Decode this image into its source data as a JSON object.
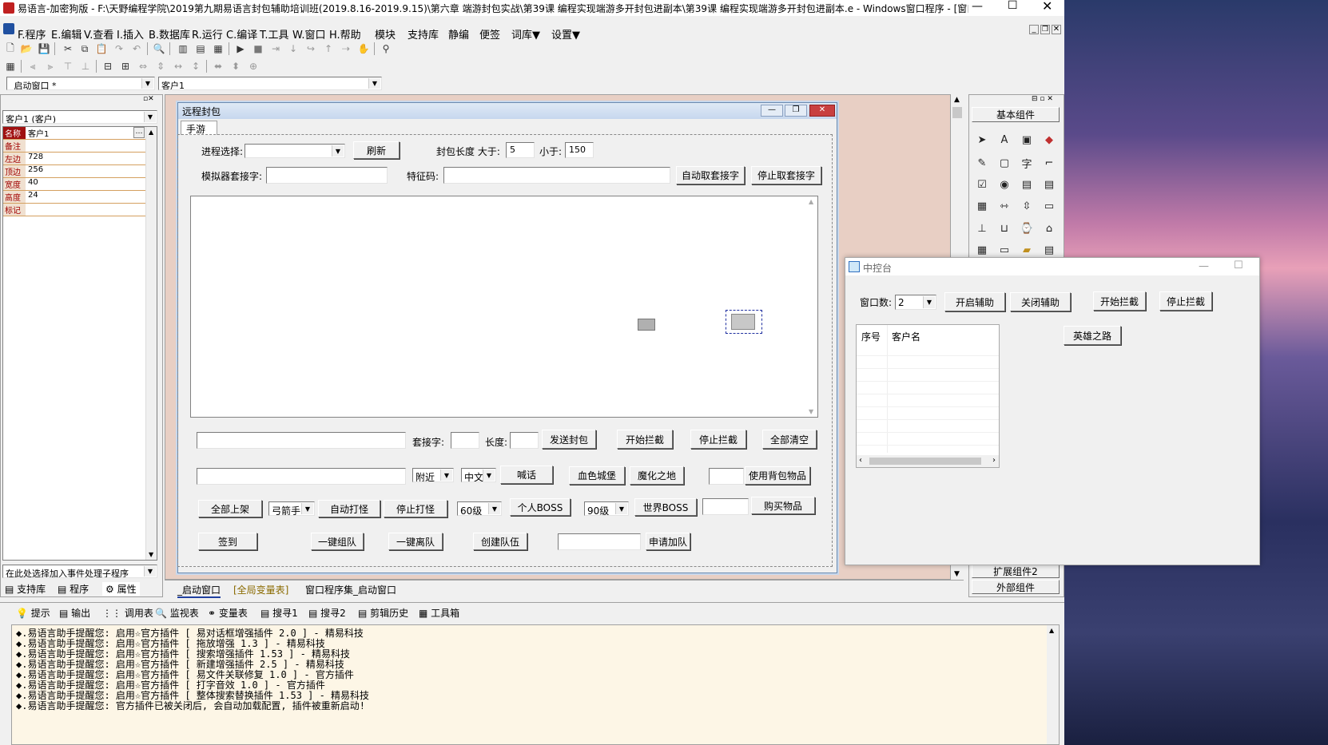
{
  "window_title": "易语言-加密狗版 - F:\\天野编程学院\\2019第九期易语言封包辅助培训班(2019.8.16-2019.9.15)\\第六章 端游封包实战\\第39课 编程实现端游多开封包进副本\\第39课 编程实现端游多开封包进副本.e - Windows窗口程序 - [窗口: _启动窗...",
  "menu": [
    "F.程序",
    "E.编辑",
    "V.查看",
    "I.插入",
    "B.数据库",
    "R.运行",
    "C.编译",
    "T.工具",
    "W.窗口",
    "H.帮助",
    "模块",
    "支持库",
    "静编",
    "便签",
    "词库▼",
    "设置▼"
  ],
  "selectors": {
    "window": "_启动窗口 *",
    "component": "客户1"
  },
  "left_panel": {
    "object_select": "客户1 (客户)",
    "props": [
      {
        "k": "名称",
        "v": "客户1"
      },
      {
        "k": "备注",
        "v": ""
      },
      {
        "k": "左边",
        "v": "728"
      },
      {
        "k": "顶边",
        "v": "256"
      },
      {
        "k": "宽度",
        "v": "40"
      },
      {
        "k": "高度",
        "v": "24"
      },
      {
        "k": "标记",
        "v": ""
      }
    ],
    "event_select": "在此处选择加入事件处理子程序",
    "tabs": [
      "支持库",
      "程序",
      "属性"
    ]
  },
  "form": {
    "title": "远程封包",
    "tab": "手游",
    "process_label": "进程选择:",
    "refresh": "刷新",
    "pkt_len_label": "封包长度  大于:",
    "gt_value": "5",
    "lt_label": "小于:",
    "lt_value": "150",
    "emu_label": "模拟器套接字:",
    "sig_label": "特征码:",
    "auto_get": "自动取套接字",
    "stop_get": "停止取套接字",
    "socket_label": "套接字:",
    "len_label": "长度:",
    "send_pkt": "发送封包",
    "start_intercept": "开始拦截",
    "stop_intercept": "停止拦截",
    "clear_all": "全部清空",
    "nearby": "附近",
    "chinese": "中文",
    "shout": "喊话",
    "blood_castle": "血色城堡",
    "magic_land": "魔化之地",
    "use_bag_item": "使用背包物品",
    "all_shelf": "全部上架",
    "archer": "弓箭手",
    "auto_fight": "自动打怪",
    "stop_fight": "停止打怪",
    "level60": "60级",
    "personal_boss": "个人BOSS",
    "level90": "90级",
    "world_boss": "世界BOSS",
    "buy_item": "购买物品",
    "sign_in": "签到",
    "one_team": "一键组队",
    "one_leave": "一键离队",
    "create_team": "创建队伍",
    "apply_join": "申请加队"
  },
  "editor_tabs": [
    "_启动窗口",
    "[全局变量表]",
    "窗口程序集_启动窗口"
  ],
  "palette": {
    "basic": "基本组件",
    "ext2": "扩展组件2",
    "external": "外部组件"
  },
  "console": {
    "title": "中控台",
    "win_count_label": "窗口数:",
    "win_count": "2",
    "open_assist": "开启辅助",
    "close_assist": "关闭辅助",
    "start_intercept": "开始拦截",
    "stop_intercept": "停止拦截",
    "col_index": "序号",
    "col_name": "客户名",
    "hero_road": "英雄之路"
  },
  "bottom_tabs": [
    "提示",
    "输出",
    "调用表",
    "监视表",
    "变量表",
    "搜寻1",
    "搜寻2",
    "剪辑历史",
    "工具箱"
  ],
  "log_lines": [
    "◆.易语言助手提醒您: 启用☆官方插件 [ 易对话框增强插件 2.0 ] - 精易科技",
    "◆.易语言助手提醒您: 启用☆官方插件 [ 拖放增强 1.3 ] - 精易科技",
    "◆.易语言助手提醒您: 启用☆官方插件 [ 搜索增强插件 1.53 ] - 精易科技",
    "◆.易语言助手提醒您: 启用☆官方插件 [ 新建增强插件 2.5 ] - 精易科技",
    "◆.易语言助手提醒您: 启用☆官方插件 [ 易文件关联修复 1.0 ] - 官方插件",
    "◆.易语言助手提醒您: 启用☆官方插件 [ 打字音效 1.0 ] - 官方插件",
    "◆.易语言助手提醒您: 启用☆官方插件 [ 整体搜索替换插件 1.53 ] - 精易科技",
    "◆.易语言助手提醒您: 官方插件已被关闭后, 会自动加载配置, 插件被重新启动!"
  ]
}
